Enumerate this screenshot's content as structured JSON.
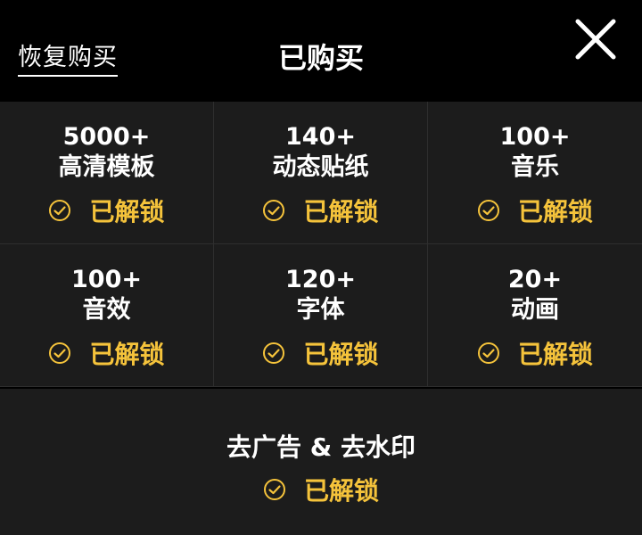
{
  "header": {
    "restore_label": "恢复购买",
    "title": "已购买",
    "close_icon": "close-icon"
  },
  "features": [
    {
      "count": "5000+",
      "name": "高清模板",
      "status": "已解锁"
    },
    {
      "count": "140+",
      "name": "动态贴纸",
      "status": "已解锁"
    },
    {
      "count": "100+",
      "name": "音乐",
      "status": "已解锁"
    },
    {
      "count": "100+",
      "name": "音效",
      "status": "已解锁"
    },
    {
      "count": "120+",
      "name": "字体",
      "status": "已解锁"
    },
    {
      "count": "20+",
      "name": "动画",
      "status": "已解锁"
    }
  ],
  "bottom": {
    "label": "去广告 & 去水印",
    "status": "已解锁"
  },
  "colors": {
    "accent": "#f5c33b",
    "background": "#000000",
    "panel": "#1c1c1c"
  }
}
